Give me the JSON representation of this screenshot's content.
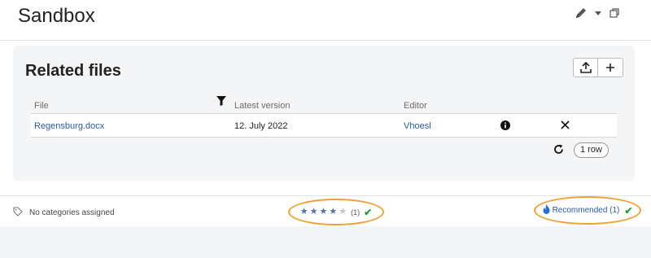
{
  "header": {
    "title": "Sandbox",
    "icons": [
      "pencil-icon",
      "caret-down-icon",
      "restore-window-icon"
    ]
  },
  "panel": {
    "title": "Related files",
    "buttons": [
      "upload-icon",
      "plus-icon"
    ],
    "table": {
      "columns": [
        "File",
        "Latest version",
        "Editor"
      ],
      "rows": [
        {
          "file": "Regensburg.docx",
          "version": "12. July 2022",
          "editor": "Vhoesl"
        }
      ],
      "row_count": "1 row"
    }
  },
  "footer": {
    "categories": "No categories assigned",
    "rating": {
      "stars": 4,
      "max": 5,
      "count": "(1)"
    },
    "recommended": "Recommended (1)"
  },
  "colors": {
    "accent": "#2a5aa0",
    "highlight": "#f0a030",
    "check": "#2a9a3a"
  }
}
